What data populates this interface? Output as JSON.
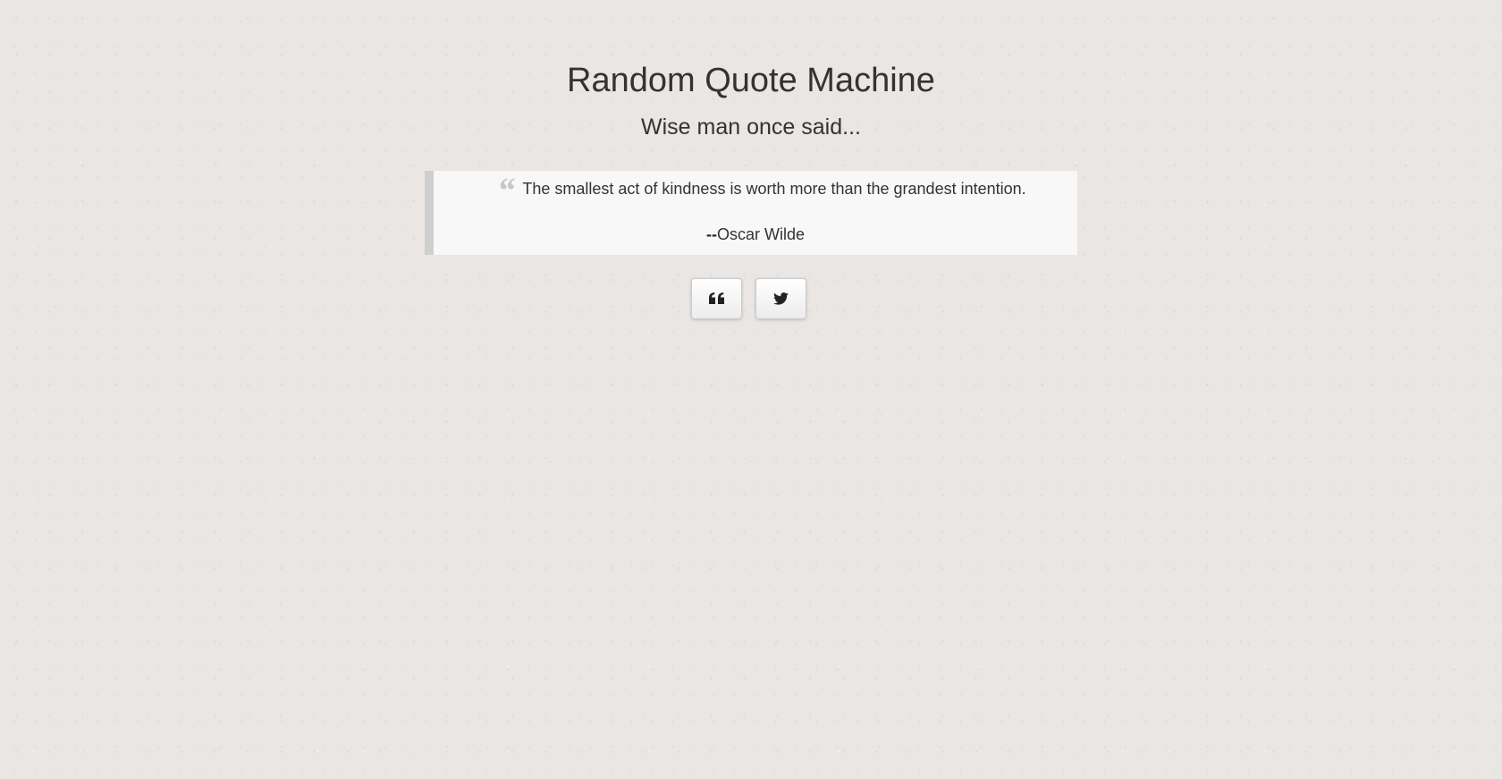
{
  "header": {
    "title": "Random Quote Machine",
    "subtitle": "Wise man once said..."
  },
  "quote": {
    "mark": "“",
    "text": "The smallest act of kindness is worth more than the grandest intention.",
    "author_prefix": "--",
    "author": "Oscar Wilde"
  },
  "actions": [
    {
      "name": "new-quote-button",
      "icon": "quote-left-icon"
    },
    {
      "name": "tweet-button",
      "icon": "twitter-icon"
    }
  ],
  "colors": {
    "background": "#e9e6e3",
    "text": "#333333",
    "quote_box": "#f8f8f8",
    "quote_border": "#cfcfcf",
    "quote_mark": "#c8c8c8"
  }
}
